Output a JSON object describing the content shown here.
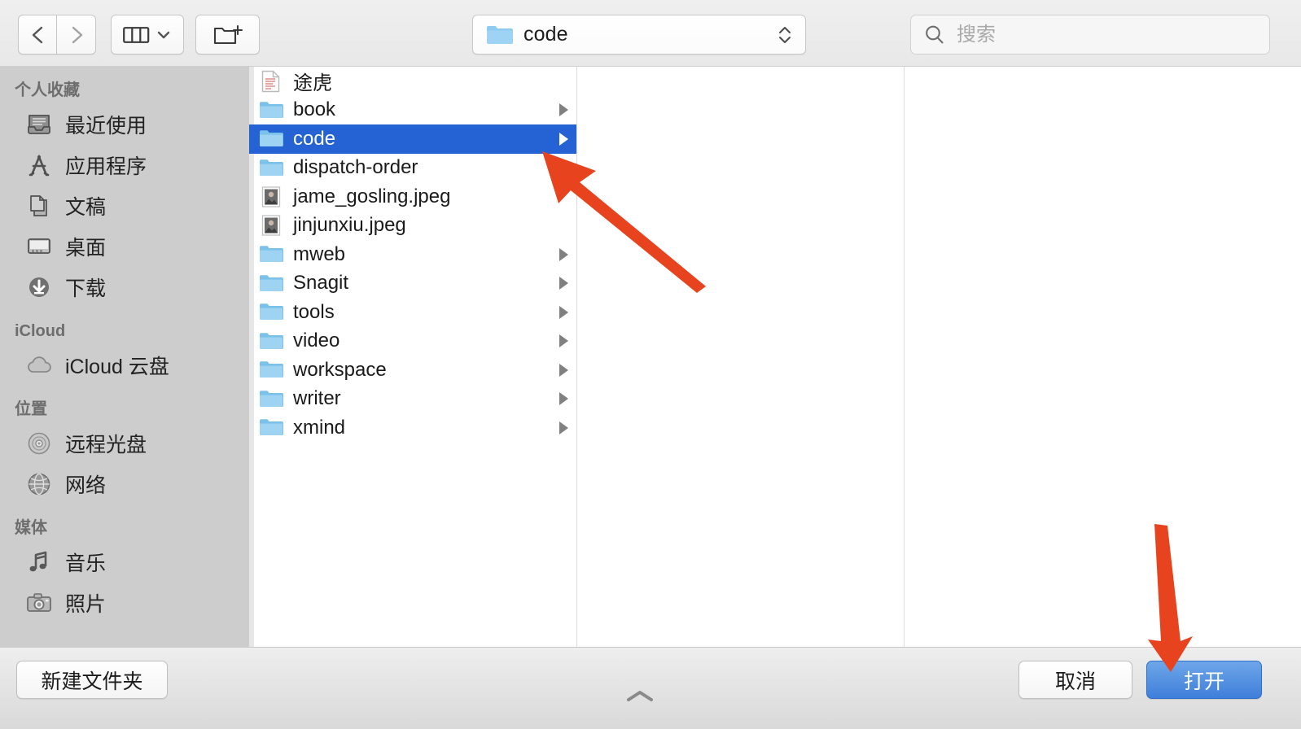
{
  "window": {
    "title": "File Open Dialog",
    "accent_selection": "#2563d4",
    "annotation_color": "#e8431f"
  },
  "toolbar": {
    "back_icon": "chevron-left-icon",
    "forward_icon": "chevron-right-icon",
    "view_mode_icon": "column-view-icon",
    "view_mode_chevron": "chevron-down-icon",
    "new_folder_icon": "new-folder-icon",
    "path": {
      "label": "code",
      "icon": "folder-icon",
      "stepper_icon": "updown-stepper-icon"
    },
    "search": {
      "icon": "search-icon",
      "placeholder": "搜索",
      "value": ""
    }
  },
  "sidebar": {
    "sections": [
      {
        "title": "个人收藏",
        "items": [
          {
            "label": "最近使用",
            "icon": "recents-icon"
          },
          {
            "label": "应用程序",
            "icon": "applications-icon"
          },
          {
            "label": "文稿",
            "icon": "documents-icon"
          },
          {
            "label": "桌面",
            "icon": "desktop-icon"
          },
          {
            "label": "下载",
            "icon": "downloads-icon"
          }
        ]
      },
      {
        "title": "iCloud",
        "items": [
          {
            "label": "iCloud 云盘",
            "icon": "icloud-drive-icon"
          }
        ]
      },
      {
        "title": "位置",
        "items": [
          {
            "label": "远程光盘",
            "icon": "remote-disc-icon"
          },
          {
            "label": "网络",
            "icon": "network-icon"
          }
        ]
      },
      {
        "title": "媒体",
        "items": [
          {
            "label": "音乐",
            "icon": "music-icon"
          },
          {
            "label": "照片",
            "icon": "photos-icon"
          }
        ]
      }
    ]
  },
  "file_list": {
    "items": [
      {
        "name": "途虎",
        "type": "document",
        "has_children": false,
        "selected": false
      },
      {
        "name": "book",
        "type": "folder",
        "has_children": true,
        "selected": false
      },
      {
        "name": "code",
        "type": "folder",
        "has_children": true,
        "selected": true
      },
      {
        "name": "dispatch-order",
        "type": "folder",
        "has_children": false,
        "selected": false
      },
      {
        "name": "jame_gosling.jpeg",
        "type": "image",
        "has_children": false,
        "selected": false
      },
      {
        "name": "jinjunxiu.jpeg",
        "type": "image",
        "has_children": false,
        "selected": false
      },
      {
        "name": "mweb",
        "type": "folder",
        "has_children": true,
        "selected": false
      },
      {
        "name": "Snagit",
        "type": "folder",
        "has_children": true,
        "selected": false
      },
      {
        "name": "tools",
        "type": "folder",
        "has_children": true,
        "selected": false
      },
      {
        "name": "video",
        "type": "folder",
        "has_children": true,
        "selected": false
      },
      {
        "name": "workspace",
        "type": "folder",
        "has_children": true,
        "selected": false
      },
      {
        "name": "writer",
        "type": "folder",
        "has_children": true,
        "selected": false
      },
      {
        "name": "xmind",
        "type": "folder",
        "has_children": true,
        "selected": false
      }
    ]
  },
  "bottombar": {
    "new_folder_label": "新建文件夹",
    "cancel_label": "取消",
    "open_label": "打开",
    "resize_icon": "chevron-up-icon"
  },
  "annotations": [
    {
      "name": "arrow-pointing-to-code-row",
      "icon": "arrow-up-left-icon"
    },
    {
      "name": "arrow-pointing-to-open-button",
      "icon": "arrow-down-icon"
    }
  ]
}
